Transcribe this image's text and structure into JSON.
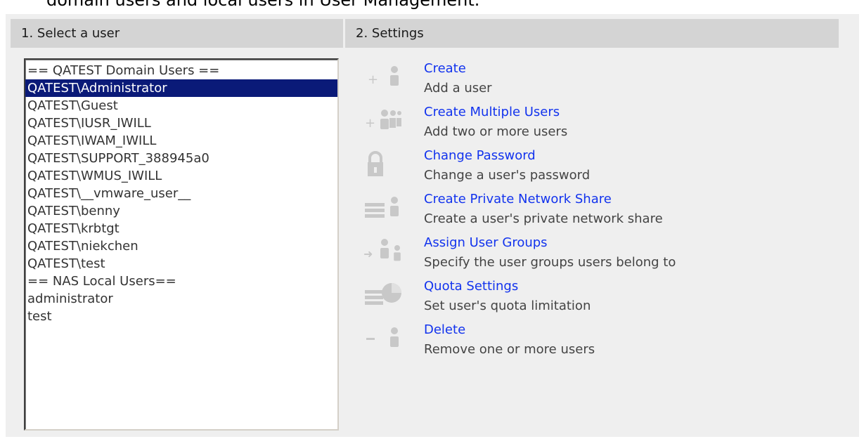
{
  "caption": "domain users and local users in User Management.",
  "left_header": "1. Select a user",
  "right_header": "2. Settings",
  "users": [
    {
      "label": "== QATEST Domain Users =="
    },
    {
      "label": "QATEST\\Administrator",
      "selected": true
    },
    {
      "label": "QATEST\\Guest"
    },
    {
      "label": "QATEST\\IUSR_IWILL"
    },
    {
      "label": "QATEST\\IWAM_IWILL"
    },
    {
      "label": "QATEST\\SUPPORT_388945a0"
    },
    {
      "label": "QATEST\\WMUS_IWILL"
    },
    {
      "label": "QATEST\\__vmware_user__"
    },
    {
      "label": "QATEST\\benny"
    },
    {
      "label": "QATEST\\krbtgt"
    },
    {
      "label": "QATEST\\niekchen"
    },
    {
      "label": "QATEST\\test"
    },
    {
      "label": "== NAS Local Users=="
    },
    {
      "label": "administrator"
    },
    {
      "label": "test"
    }
  ],
  "actions": [
    {
      "icon": "add-user-icon",
      "title": "Create",
      "desc": "Add a user"
    },
    {
      "icon": "add-multiple-users-icon",
      "title": "Create Multiple Users",
      "desc": "Add two or more users"
    },
    {
      "icon": "lock-icon",
      "title": "Change Password",
      "desc": "Change a user's password"
    },
    {
      "icon": "network-share-icon",
      "title": "Create Private Network Share",
      "desc": "Create a user's private network share"
    },
    {
      "icon": "assign-groups-icon",
      "title": "Assign User Groups",
      "desc": "Specify the user groups users belong to"
    },
    {
      "icon": "quota-icon",
      "title": "Quota Settings",
      "desc": "Set user's quota limitation"
    },
    {
      "icon": "delete-user-icon",
      "title": "Delete",
      "desc": "Remove one or more users"
    }
  ],
  "colors": {
    "panel_bg": "#efefef",
    "header_bg": "#d4d4d4",
    "selected_bg": "#0a1a78",
    "link": "#1233ee",
    "icon_gray": "#c8c8c8"
  }
}
